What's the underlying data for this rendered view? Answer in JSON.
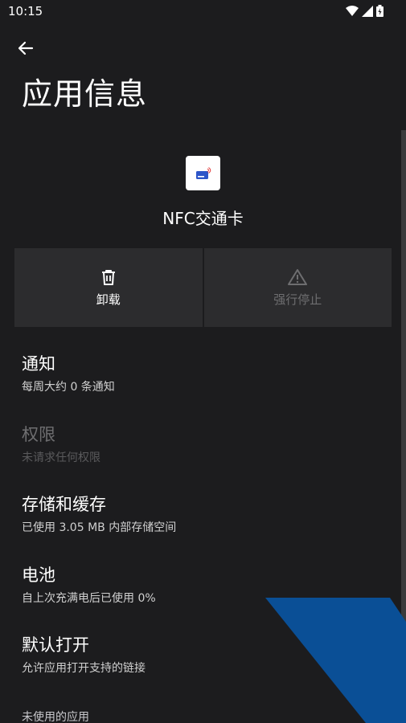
{
  "status_bar": {
    "time": "10:15"
  },
  "header": {
    "title": "应用信息"
  },
  "app": {
    "name": "NFC交通卡"
  },
  "actions": [
    {
      "label": "卸载"
    },
    {
      "label": "强行停止"
    }
  ],
  "settings": [
    {
      "title": "通知",
      "subtitle": "每周大约 0 条通知"
    },
    {
      "title": "权限",
      "subtitle": "未请求任何权限"
    },
    {
      "title": "存储和缓存",
      "subtitle": "已使用 3.05 MB 内部存储空间"
    },
    {
      "title": "电池",
      "subtitle": "自上次充满电后已使用 0%"
    },
    {
      "title": "默认打开",
      "subtitle": "允许应用打开支持的链接"
    }
  ],
  "section": {
    "unused_apps": "未使用的应用"
  },
  "colors": {
    "background": "#1c1c1e",
    "panel": "#2c2c2e",
    "disabled": "#6e6e70",
    "watermark_blue": "#0a4f96"
  }
}
